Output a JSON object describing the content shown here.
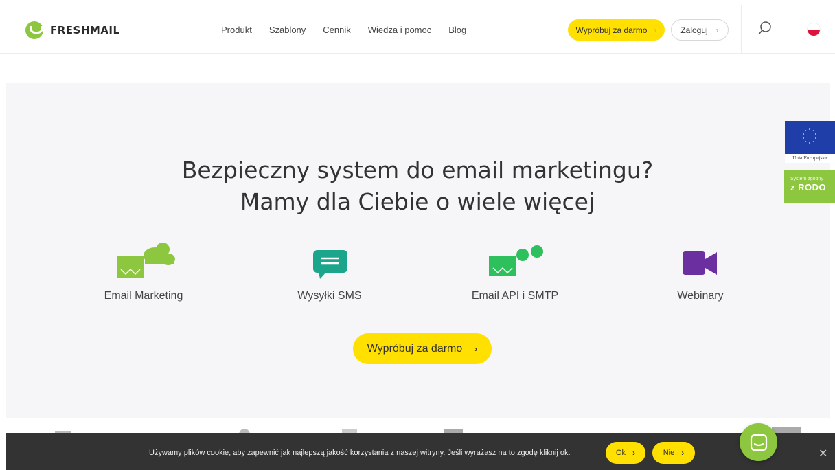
{
  "header": {
    "logo_text": "FRESHMAIL",
    "nav": [
      "Produkt",
      "Szablony",
      "Cennik",
      "Wiedza i pomoc",
      "Blog"
    ],
    "try_label": "Wypróbuj za darmo",
    "login_label": "Zaloguj",
    "search_icon": "search-icon",
    "language_flag": "poland-flag-icon"
  },
  "hero": {
    "title_line1": "Bezpieczny system do email marketingu?",
    "title_line2": "Mamy dla Ciebie o wiele więcej",
    "features": [
      {
        "label": "Email Marketing",
        "icon": "email-cloud-icon"
      },
      {
        "label": "Wysyłki SMS",
        "icon": "sms-bubble-icon"
      },
      {
        "label": "Email API i SMTP",
        "icon": "email-api-icon"
      },
      {
        "label": "Webinary",
        "icon": "video-camera-icon"
      }
    ],
    "cta_label": "Wypróbuj za darmo"
  },
  "side_badges": {
    "eu_text": "Unia Europejska",
    "rodo_small": "System zgodny",
    "rodo_big": "z RODO"
  },
  "cookie": {
    "text": "Używamy plików cookie, aby zapewnić jak najlepszą jakość korzystania z naszej witryny. Jeśli wyrażasz na to zgodę kliknij ok.",
    "ok_label": "Ok",
    "no_label": "Nie",
    "close_icon": "close-icon"
  },
  "colors": {
    "brand_green": "#8dc63f",
    "accent_yellow": "#ffe000",
    "sms_teal": "#1ba58a",
    "webinar_purple": "#6b2fa0",
    "cookie_bg": "#333333"
  }
}
